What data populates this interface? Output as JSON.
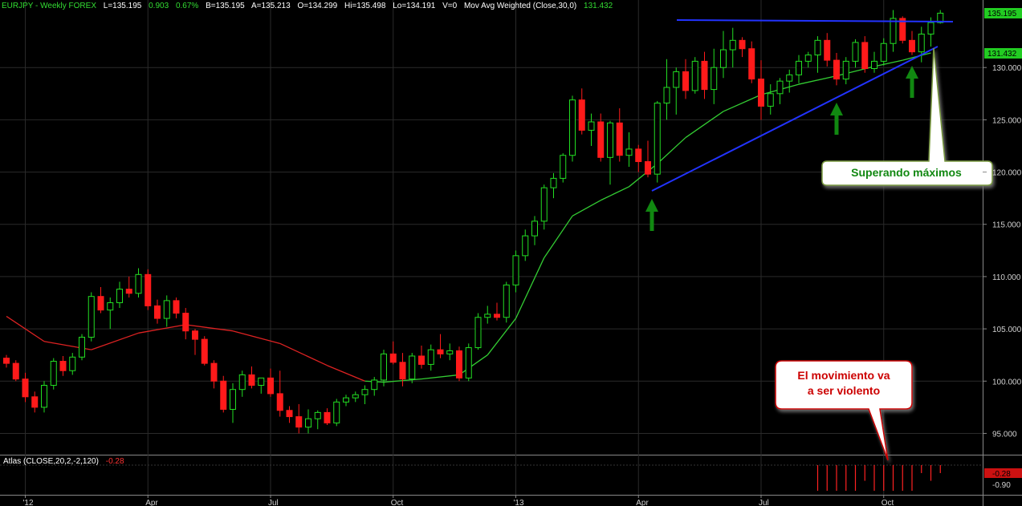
{
  "header": {
    "symbol": "EURJPY - Weekly  FOREX",
    "last": "L=135.195",
    "change": "0.903",
    "change_pct": "0.67%",
    "bid": "B=135.195",
    "ask": "A=135.213",
    "open": "O=134.299",
    "high": "Hi=135.498",
    "low": "Lo=134.191",
    "volume": "V=0",
    "ma_label": "Mov Avg Weighted (Close,30,0)",
    "ma_value": "131.432"
  },
  "indicator": {
    "label": "Atlas (CLOSE,20,2,-2,120)",
    "value": "-0.28",
    "axis_badge": "-0.28",
    "axis_tick": "-0.90"
  },
  "price_badges": {
    "last": "135.195",
    "ma": "131.432"
  },
  "annotations": {
    "breakout": "Superando máximos",
    "violent_line1": "El movimiento va",
    "violent_line2": "a ser violento"
  },
  "colors": {
    "bull": "#22dd22",
    "bear": "#ff1a1a",
    "ma_green": "#33cc33",
    "ma_red": "#dd2222",
    "trendline": "#2233ff",
    "arrow": "#118811",
    "callout_border": "#cc0000"
  },
  "chart_data": {
    "type": "candlestick",
    "title": "EURJPY - Weekly  FOREX",
    "yticks": [
      "95.000",
      "100.000",
      "105.000",
      "110.000",
      "115.000",
      "120.000",
      "125.000",
      "130.000"
    ],
    "xticks": [
      "'12",
      "Apr",
      "Jul",
      "Oct",
      "'13",
      "Apr",
      "Jul",
      "Oct"
    ],
    "ylim": [
      93.5,
      136
    ],
    "x_index_range": [
      0,
      98
    ],
    "xtick_index": [
      2,
      15,
      28,
      41,
      54,
      67,
      80,
      93
    ],
    "grid": true,
    "series": [
      {
        "kind": "candles",
        "candles": [
          [
            102.2,
            102.5,
            101.3,
            101.7
          ],
          [
            101.7,
            102.0,
            100.0,
            100.2
          ],
          [
            100.2,
            100.8,
            98.0,
            98.5
          ],
          [
            98.5,
            99.0,
            97.0,
            97.5
          ],
          [
            97.5,
            100.0,
            97.0,
            99.6
          ],
          [
            99.6,
            102.2,
            99.2,
            101.9
          ],
          [
            101.9,
            102.4,
            100.5,
            101.0
          ],
          [
            101.0,
            102.7,
            100.6,
            102.3
          ],
          [
            102.3,
            104.5,
            102.0,
            104.2
          ],
          [
            104.2,
            108.5,
            103.8,
            108.1
          ],
          [
            108.1,
            109.0,
            106.5,
            106.8
          ],
          [
            106.8,
            108.0,
            105.0,
            107.5
          ],
          [
            107.5,
            109.5,
            107.0,
            108.8
          ],
          [
            108.8,
            110.0,
            108.0,
            108.4
          ],
          [
            108.4,
            110.8,
            108.0,
            110.2
          ],
          [
            110.2,
            110.7,
            106.8,
            107.2
          ],
          [
            107.2,
            107.8,
            105.5,
            106.0
          ],
          [
            106.0,
            108.2,
            105.2,
            107.7
          ],
          [
            107.7,
            108.0,
            106.0,
            106.5
          ],
          [
            106.5,
            107.0,
            104.0,
            104.8
          ],
          [
            104.8,
            105.0,
            102.5,
            104.0
          ],
          [
            104.0,
            104.3,
            101.5,
            101.7
          ],
          [
            101.7,
            102.0,
            99.3,
            100.0
          ],
          [
            100.0,
            100.5,
            97.0,
            97.3
          ],
          [
            97.3,
            99.8,
            96.0,
            99.2
          ],
          [
            99.2,
            101.0,
            98.5,
            100.6
          ],
          [
            100.6,
            101.4,
            99.3,
            99.6
          ],
          [
            99.6,
            100.1,
            98.8,
            100.3
          ],
          [
            100.3,
            101.2,
            98.5,
            98.8
          ],
          [
            98.8,
            101.0,
            96.6,
            97.2
          ],
          [
            97.2,
            97.6,
            96.0,
            96.6
          ],
          [
            96.6,
            97.8,
            95.0,
            95.6
          ],
          [
            95.6,
            97.3,
            95.0,
            96.4
          ],
          [
            96.4,
            97.2,
            95.4,
            97.0
          ],
          [
            97.0,
            97.4,
            95.8,
            96.0
          ],
          [
            96.0,
            98.3,
            95.7,
            98.0
          ],
          [
            98.0,
            98.7,
            97.6,
            98.4
          ],
          [
            98.4,
            99.0,
            98.0,
            98.7
          ],
          [
            98.7,
            99.6,
            97.8,
            99.2
          ],
          [
            99.2,
            100.4,
            98.6,
            100.1
          ],
          [
            100.1,
            103.0,
            99.5,
            102.6
          ],
          [
            102.6,
            103.8,
            101.6,
            101.8
          ],
          [
            101.8,
            102.7,
            99.5,
            100.2
          ],
          [
            100.2,
            102.7,
            99.8,
            102.4
          ],
          [
            102.4,
            103.4,
            101.2,
            101.6
          ],
          [
            101.6,
            103.5,
            101.0,
            103.0
          ],
          [
            103.0,
            104.5,
            102.2,
            102.6
          ],
          [
            102.6,
            103.6,
            102.0,
            102.9
          ],
          [
            102.9,
            103.3,
            100.0,
            100.3
          ],
          [
            100.3,
            103.6,
            100.0,
            103.2
          ],
          [
            103.2,
            106.5,
            103.0,
            106.1
          ],
          [
            106.1,
            107.2,
            105.5,
            106.4
          ],
          [
            106.4,
            107.5,
            105.8,
            106.1
          ],
          [
            106.1,
            109.5,
            105.6,
            109.2
          ],
          [
            109.2,
            112.5,
            108.5,
            112.0
          ],
          [
            112.0,
            114.5,
            111.5,
            113.9
          ],
          [
            113.9,
            115.8,
            113.0,
            115.3
          ],
          [
            115.3,
            118.8,
            114.5,
            118.5
          ],
          [
            118.5,
            119.9,
            117.5,
            119.4
          ],
          [
            119.4,
            121.8,
            119.0,
            121.6
          ],
          [
            121.6,
            127.3,
            121.0,
            126.9
          ],
          [
            126.9,
            128.0,
            123.6,
            124.0
          ],
          [
            124.0,
            125.6,
            122.5,
            124.8
          ],
          [
            124.8,
            125.6,
            121.0,
            121.4
          ],
          [
            121.4,
            124.9,
            118.8,
            124.7
          ],
          [
            124.7,
            126.1,
            121.0,
            121.6
          ],
          [
            121.6,
            123.8,
            120.5,
            122.2
          ],
          [
            122.2,
            122.6,
            120.0,
            121.0
          ],
          [
            121.0,
            123.0,
            119.5,
            119.8
          ],
          [
            119.8,
            126.8,
            119.0,
            126.6
          ],
          [
            126.6,
            130.8,
            125.0,
            128.1
          ],
          [
            128.1,
            130.0,
            125.5,
            129.6
          ],
          [
            129.6,
            130.8,
            127.0,
            127.8
          ],
          [
            127.8,
            131.0,
            127.5,
            130.6
          ],
          [
            130.6,
            131.5,
            127.0,
            127.9
          ],
          [
            127.9,
            131.8,
            126.5,
            130.0
          ],
          [
            130.0,
            133.5,
            129.0,
            131.7
          ],
          [
            131.7,
            133.8,
            130.0,
            132.6
          ],
          [
            132.6,
            132.9,
            131.0,
            131.8
          ],
          [
            131.8,
            132.5,
            128.5,
            128.9
          ],
          [
            128.9,
            130.7,
            125.0,
            126.3
          ],
          [
            126.3,
            128.4,
            125.5,
            127.5
          ],
          [
            127.5,
            129.0,
            126.5,
            128.7
          ],
          [
            128.7,
            129.8,
            127.6,
            129.3
          ],
          [
            129.3,
            131.2,
            128.5,
            130.6
          ],
          [
            130.6,
            131.5,
            130.0,
            131.2
          ],
          [
            131.2,
            133.0,
            129.5,
            132.6
          ],
          [
            132.6,
            133.3,
            130.1,
            130.7
          ],
          [
            130.7,
            131.4,
            128.3,
            128.9
          ],
          [
            128.9,
            131.0,
            128.4,
            130.6
          ],
          [
            130.6,
            132.7,
            130.0,
            132.4
          ],
          [
            132.4,
            133.0,
            129.5,
            129.9
          ],
          [
            129.9,
            131.5,
            129.5,
            130.6
          ],
          [
            130.6,
            132.8,
            130.2,
            132.3
          ],
          [
            132.3,
            135.5,
            131.5,
            134.7
          ],
          [
            134.7,
            134.9,
            132.3,
            132.6
          ],
          [
            132.6,
            133.5,
            131.2,
            131.5
          ],
          [
            131.5,
            133.9,
            130.5,
            133.2
          ],
          [
            133.2,
            134.8,
            132.0,
            134.3
          ],
          [
            134.3,
            135.5,
            134.2,
            135.2
          ]
        ]
      },
      {
        "name": "Mov Avg Weighted (Close,30,0)",
        "kind": "line",
        "x": [
          0,
          4,
          9,
          14,
          19,
          24,
          29,
          34,
          38,
          40,
          44,
          48,
          51,
          54,
          57,
          60,
          63,
          66,
          69,
          72,
          76,
          80,
          84,
          88,
          92,
          95,
          98
        ],
        "y": [
          106.2,
          103.8,
          103.0,
          104.6,
          105.4,
          104.8,
          103.6,
          101.5,
          100.0,
          99.9,
          100.2,
          100.6,
          102.5,
          106.0,
          111.8,
          115.8,
          117.3,
          118.6,
          120.8,
          123.3,
          125.8,
          127.4,
          128.4,
          129.2,
          130.1,
          130.7,
          131.4
        ]
      }
    ],
    "atlas_values": [
      -0.9,
      -0.9,
      -0.9,
      -0.9,
      -0.9,
      -0.55,
      -0.9,
      -0.9,
      -0.9,
      -0.9,
      -0.9,
      -0.28,
      -0.55,
      -0.28
    ]
  }
}
